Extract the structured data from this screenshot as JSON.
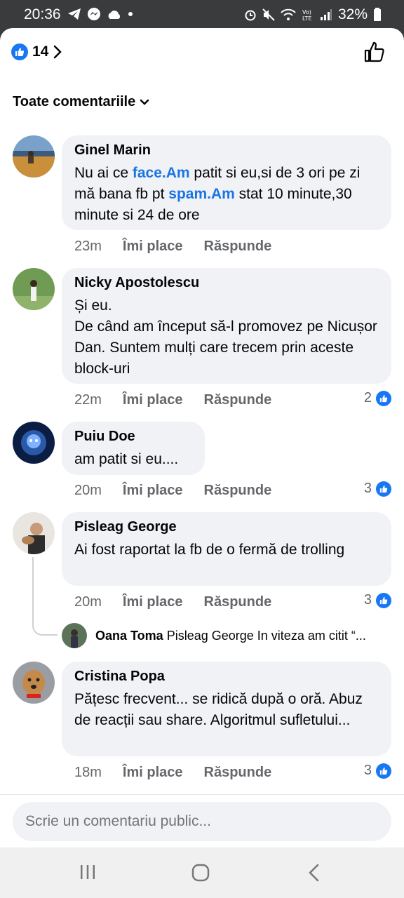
{
  "status_bar": {
    "time": "20:36",
    "battery": "32%"
  },
  "header": {
    "reaction_count": "14"
  },
  "filter": {
    "label": "Toate comentariile"
  },
  "comments": [
    {
      "author": "Ginel Marin",
      "segments": [
        {
          "t": "Nu ai ce "
        },
        {
          "t": "face.Am",
          "link": true
        },
        {
          "t": " patit si eu,si de 3 ori pe zi mă bana fb pt "
        },
        {
          "t": "spam.Am",
          "link": true
        },
        {
          "t": " stat 10 minute,30 minute si 24 de ore"
        }
      ],
      "time": "23m",
      "likes": ""
    },
    {
      "author": "Nicky Apostolescu",
      "text": "Și eu.\nDe când am început să-l promovez pe Nicușor Dan. Suntem mulți care trecem prin aceste block-uri",
      "time": "22m",
      "likes": "2"
    },
    {
      "author": "Puiu Doe",
      "text": "am patit si eu....",
      "time": "20m",
      "likes": "3"
    },
    {
      "author": "Pisleag George",
      "text": "Ai fost raportat la fb de o fermă de trolling",
      "time": "20m",
      "likes": "3",
      "reply": {
        "author": "Oana Toma",
        "text": "Pisleag George In viteza am citit “..."
      }
    },
    {
      "author": "Cristina Popa",
      "text": "Pățesc frecvent... se ridică după o oră. Abuz de reacții sau share. Algoritmul sufletului...",
      "time": "18m",
      "likes": "3"
    }
  ],
  "actions": {
    "like_label": "Îmi place",
    "reply_label": "Răspunde"
  },
  "composer": {
    "placeholder": "Scrie un comentariu public..."
  },
  "colors": {
    "accent": "#1877f2",
    "bubble": "#f0f2f5",
    "muted": "#65676b"
  }
}
